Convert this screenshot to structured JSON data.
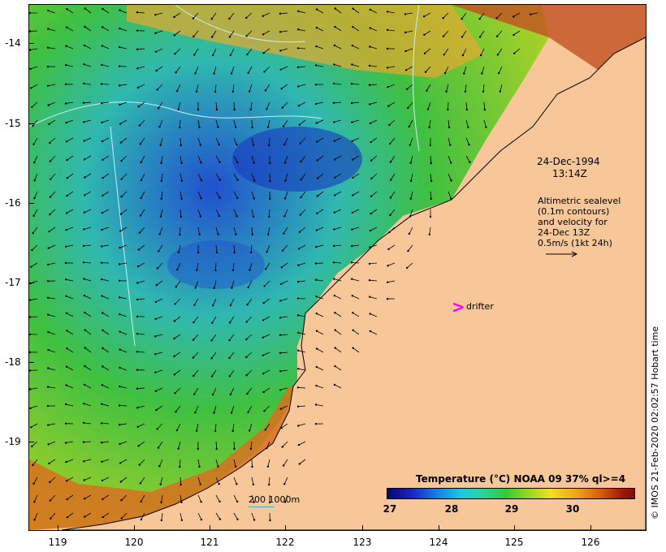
{
  "map": {
    "y_axis_labels": [
      "-14",
      "-15",
      "-16",
      "-17",
      "-18",
      "-19"
    ],
    "x_axis_labels": [
      "119",
      "120",
      "121",
      "122",
      "123",
      "124",
      "125",
      "126"
    ],
    "date_line": "24-Dec-1994",
    "time_line": "13:14Z",
    "legend_lines": [
      "Altimetric sealevel",
      "(0.1m contours)",
      "and velocity for",
      "24-Dec 13Z",
      "0.5m/s (1kt 24h)"
    ],
    "drifter_symbol": ">",
    "drifter_label": "drifter",
    "depth_contour_label": "200  1000m",
    "colorbar_title": "Temperature (°C) NOAA 09 37% ql>=4",
    "colorbar_ticks": [
      "27",
      "28",
      "29",
      "30"
    ],
    "credit": "© IMOS 21-Feb-2020 02:02:57 Hobart time",
    "colors": {
      "land": "#f7c79a",
      "drifter": "#ff00ff",
      "contour": "#40b0c0"
    }
  }
}
